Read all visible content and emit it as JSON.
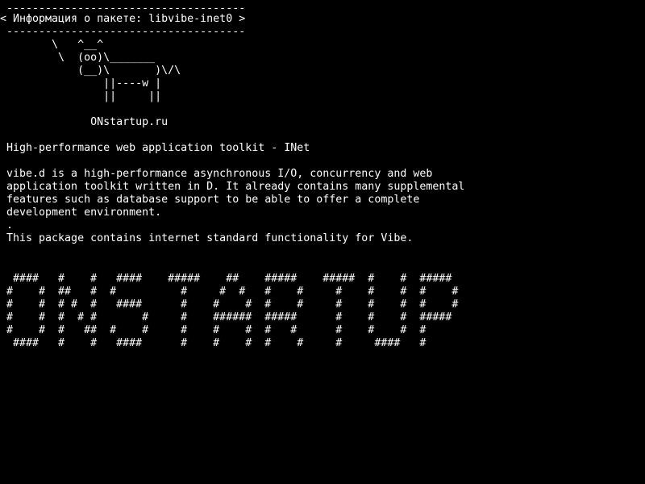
{
  "colors": {
    "background": "#000000",
    "text": "#ffffff"
  },
  "screen": {
    "lines": [
      " -------------------------------------",
      "< Информация о пакете: libvibe-inet0 >",
      " -------------------------------------",
      "        \\   ^__^",
      "         \\  (oo)\\_______",
      "            (__)\\       )\\/\\",
      "                ||----w |",
      "                ||     ||",
      "",
      "              ONstartup.ru",
      "",
      " High-performance web application toolkit - INet",
      "",
      " vibe.d is a high-performance asynchronous I/O, concurrency and web",
      " application toolkit written in D. It already contains many supplemental",
      " features such as database support to be able to offer a complete",
      " development environment.",
      " .",
      " This package contains internet standard functionality for Vibe.",
      "",
      "",
      "  ####   #    #   ####    #####    ##    #####    #####  #    #  #####",
      " #    #  ##   #  #          #     #  #   #    #     #    #    #  #    #",
      " #    #  # #  #   ####      #    #    #  #    #     #    #    #  #    #",
      " #    #  #  # #       #     #    ######  #####      #    #    #  #####",
      " #    #  #   ##  #    #     #    #    #  #   #      #    #    #  #",
      "  ####   #    #   ####      #    #    #  #    #     #     ####   #"
    ]
  }
}
